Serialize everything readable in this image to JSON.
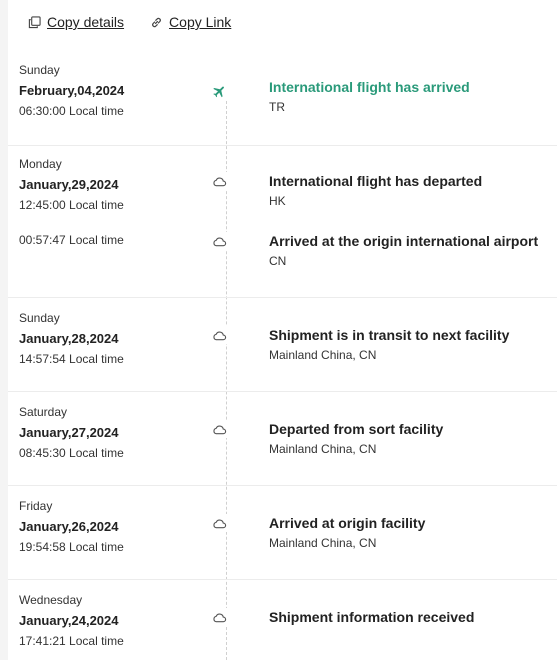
{
  "actions": {
    "copy_details": "Copy details",
    "copy_link": "Copy Link"
  },
  "colors": {
    "accent": "#2a9a7a"
  },
  "icons": {
    "plane": "plane-icon",
    "step": "cloud-icon"
  },
  "events": [
    {
      "weekday": "Sunday",
      "date": "February,04,2024",
      "time": "06:30:00 Local time",
      "status": "International flight has arrived",
      "location": "TR",
      "active": true
    },
    {
      "weekday": "Monday",
      "date": "January,29,2024",
      "time": "12:45:00 Local time",
      "status": "International flight has departed",
      "location": "HK"
    },
    {
      "time": "00:57:47 Local time",
      "status": "Arrived at the origin international airport",
      "location": "CN"
    },
    {
      "weekday": "Sunday",
      "date": "January,28,2024",
      "time": "14:57:54 Local time",
      "status": "Shipment is in transit to next facility",
      "location": "Mainland China, CN"
    },
    {
      "weekday": "Saturday",
      "date": "January,27,2024",
      "time": "08:45:30 Local time",
      "status": "Departed from sort facility",
      "location": "Mainland China, CN"
    },
    {
      "weekday": "Friday",
      "date": "January,26,2024",
      "time": "19:54:58 Local time",
      "status": "Arrived at origin facility",
      "location": "Mainland China, CN"
    },
    {
      "weekday": "Wednesday",
      "date": "January,24,2024",
      "time": "17:41:21 Local time",
      "status": "Shipment information received"
    }
  ]
}
